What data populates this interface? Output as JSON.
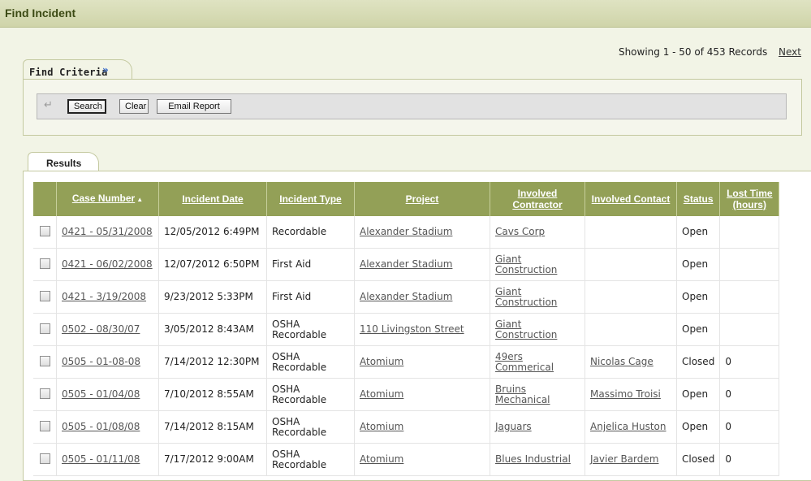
{
  "page": {
    "title": "Find Incident"
  },
  "paging": {
    "summary": "Showing 1 - 50 of 453 Records",
    "next_label": "Next"
  },
  "find_criteria": {
    "tab_label": "Find Criteria",
    "chevron_icon": "double-chevron-down-icon",
    "back_icon": "back-arrow-icon",
    "buttons": {
      "search": "Search",
      "clear": "Clear",
      "email": "Email Report"
    }
  },
  "results": {
    "tab_label": "Results",
    "columns": {
      "case_number": "Case Number",
      "sort_indicator": "▲",
      "incident_date": "Incident Date",
      "incident_type": "Incident Type",
      "project": "Project",
      "involved_contractor": "Involved Contractor",
      "involved_contact": "Involved Contact",
      "status": "Status",
      "lost_time": "Lost Time (hours)"
    },
    "rows": [
      {
        "case": "0421 - 05/31/2008",
        "date": "12/05/2012 6:49PM",
        "type": "Recordable",
        "project": "Alexander Stadium",
        "contractor": "Cavs Corp",
        "contact": "",
        "status": "Open",
        "lost": ""
      },
      {
        "case": "0421 - 06/02/2008",
        "date": "12/07/2012 6:50PM",
        "type": "First Aid",
        "project": "Alexander Stadium",
        "contractor": "Giant Construction",
        "contact": "",
        "status": "Open",
        "lost": ""
      },
      {
        "case": "0421 - 3/19/2008",
        "date": "9/23/2012 5:33PM",
        "type": "First Aid",
        "project": "Alexander Stadium",
        "contractor": "Giant Construction",
        "contact": "",
        "status": "Open",
        "lost": ""
      },
      {
        "case": "0502 - 08/30/07",
        "date": "3/05/2012 8:43AM",
        "type": "OSHA Recordable",
        "project": "110 Livingston Street",
        "contractor": "Giant Construction",
        "contact": "",
        "status": "Open",
        "lost": ""
      },
      {
        "case": "0505 - 01-08-08",
        "date": "7/14/2012 12:30PM",
        "type": "OSHA Recordable",
        "project": "Atomium",
        "contractor": "49ers Commerical",
        "contact": "Nicolas Cage",
        "status": "Closed",
        "lost": "0"
      },
      {
        "case": "0505 - 01/04/08",
        "date": "7/10/2012 8:55AM",
        "type": "OSHA Recordable",
        "project": "Atomium",
        "contractor": "Bruins Mechanical",
        "contact": "Massimo Troisi",
        "status": "Open",
        "lost": "0"
      },
      {
        "case": "0505 - 01/08/08",
        "date": "7/14/2012 8:15AM",
        "type": "OSHA Recordable",
        "project": "Atomium",
        "contractor": "Jaguars",
        "contact": "Anjelica Huston",
        "status": "Open",
        "lost": "0"
      },
      {
        "case": "0505 - 01/11/08",
        "date": "7/17/2012 9:00AM",
        "type": "OSHA Recordable",
        "project": "Atomium",
        "contractor": "Blues Industrial",
        "contact": "Javier Bardem",
        "status": "Closed",
        "lost": "0"
      }
    ]
  },
  "colors": {
    "header_green": "#93a057",
    "title_bar": "#d8dcb8",
    "accent_blue": "#3a6bc8"
  }
}
